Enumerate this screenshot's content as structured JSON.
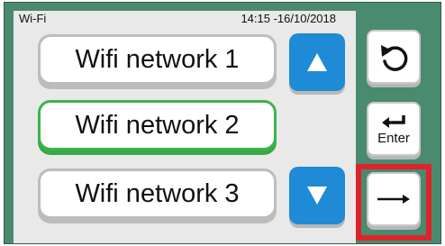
{
  "header": {
    "title": "Wi-Fi",
    "datetime": "14:15 -16/10/2018"
  },
  "networks": [
    {
      "label": "Wifi network 1",
      "selected": false
    },
    {
      "label": "Wifi network 2",
      "selected": true
    },
    {
      "label": "Wifi network 3",
      "selected": false
    }
  ],
  "scroll": {
    "up_icon": "triangle-up-icon",
    "down_icon": "triangle-down-icon"
  },
  "side_buttons": {
    "back_icon": "rotate-ccw-icon",
    "enter_label": "Enter",
    "next_icon": "arrow-right-icon"
  },
  "colors": {
    "frame": "#4a8a6f",
    "panel": "#e9e9e9",
    "selected_border": "#3cb44a",
    "scroll_button": "#1f8ad6",
    "highlight": "#e1222a"
  }
}
